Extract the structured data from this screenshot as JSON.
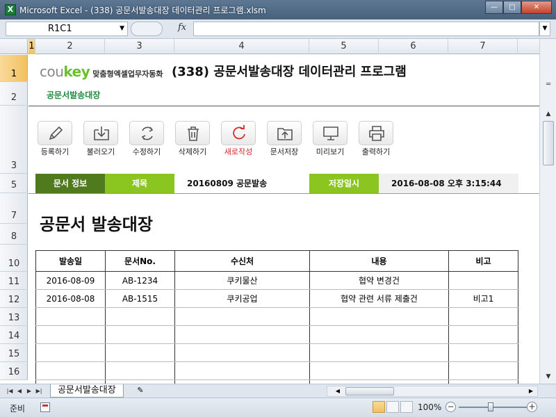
{
  "window": {
    "app_icon": "X",
    "title": "Microsoft Excel - (338) 공문서발송대장 데이터관리 프로그램.xlsm",
    "minimize": "—",
    "maximize": "□",
    "close": "✕"
  },
  "formula_bar": {
    "name_box": "R1C1",
    "fx_label": "fx",
    "formula": ""
  },
  "columns": [
    {
      "label": "1"
    },
    {
      "label": "2"
    },
    {
      "label": "3"
    },
    {
      "label": "4"
    },
    {
      "label": "5"
    },
    {
      "label": "6"
    },
    {
      "label": "7"
    }
  ],
  "rows": [
    "1",
    "2",
    "3",
    "5",
    "7",
    "8",
    "10",
    "11",
    "12",
    "13",
    "14",
    "15",
    "16"
  ],
  "header": {
    "logo_cou": "cou",
    "logo_key": "key",
    "logo_tagline": "맞춤형엑셀업무자동화",
    "title": "(338) 공문서발송대장 데이터관리 프로그램",
    "subtitle": "공문서발송대장"
  },
  "toolbar": {
    "register": "등록하기",
    "load": "불러오기",
    "edit": "수정하기",
    "delete": "삭제하기",
    "new": "새로작성",
    "save": "문서저장",
    "preview": "미리보기",
    "print": "출력하기"
  },
  "info": {
    "doc_info_label": "문서 정보",
    "subject_label": "제목",
    "subject_value": "20160809 공문발송",
    "saved_label": "저장일시",
    "saved_value": "2016-08-08 오후 3:15:44"
  },
  "sheet_title": "공문서 발송대장",
  "table": {
    "headers": [
      "발송일",
      "문서No.",
      "수신처",
      "내용",
      "비고"
    ],
    "rows": [
      [
        "2016-08-09",
        "AB-1234",
        "쿠키물산",
        "협약 변경건",
        ""
      ],
      [
        "2016-08-08",
        "AB-1515",
        "쿠키공업",
        "협약 관련 서류 제출건",
        "비고1"
      ]
    ]
  },
  "tabs": {
    "sheet_name": "공문서발송대장"
  },
  "status": {
    "mode": "준비",
    "zoom": "100%"
  },
  "colors": {
    "accent_dark_green": "#4f7a1d",
    "accent_light_green": "#8bc51f",
    "subtitle_green": "#1d8a3f",
    "new_button_red": "#d02a2a"
  }
}
